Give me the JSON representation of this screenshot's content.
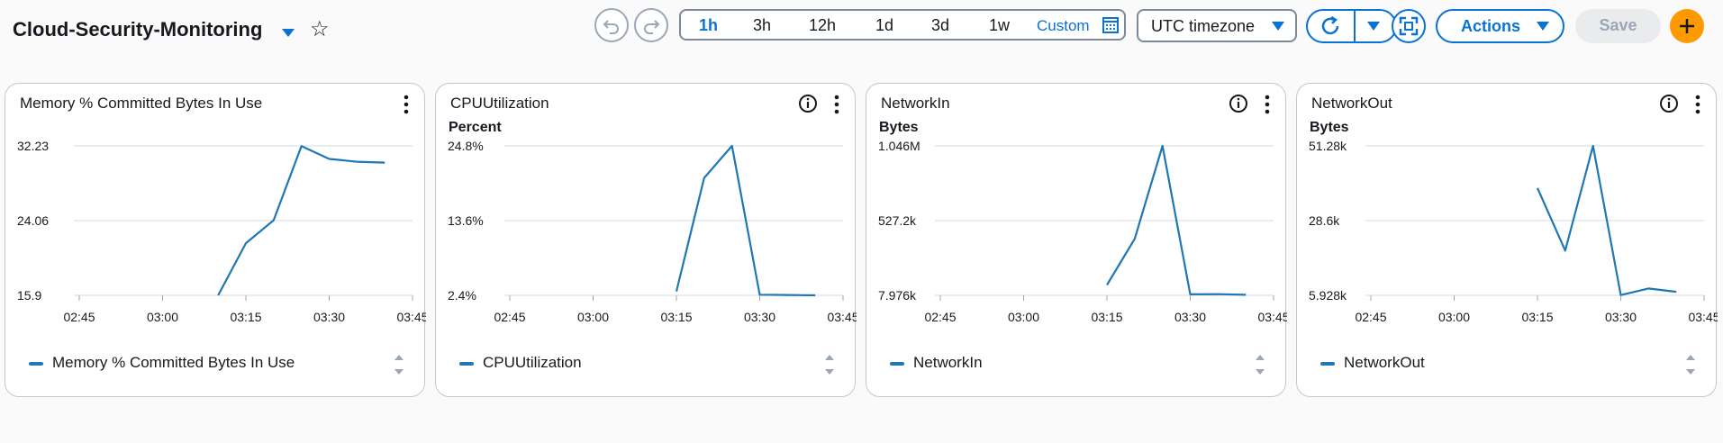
{
  "header": {
    "title": "Cloud-Security-Monitoring",
    "time_ranges": [
      {
        "label": "1h",
        "active": true
      },
      {
        "label": "3h",
        "active": false
      },
      {
        "label": "12h",
        "active": false
      },
      {
        "label": "1d",
        "active": false
      },
      {
        "label": "3d",
        "active": false
      },
      {
        "label": "1w",
        "active": false
      }
    ],
    "custom_label": "Custom",
    "timezone_label": "UTC timezone",
    "actions_label": "Actions",
    "save_label": "Save",
    "accent_color": "#0972d3",
    "add_color": "#ff9900"
  },
  "chart_data": [
    {
      "type": "line",
      "title": "Memory % Committed Bytes In Use",
      "ylabel": "",
      "yticks": [
        "32.23",
        "24.06",
        "15.9"
      ],
      "ylim": [
        15.9,
        32.23
      ],
      "xticks": [
        "02:45",
        "03:00",
        "03:15",
        "03:30",
        "03:45"
      ],
      "series": [
        {
          "name": "Memory % Committed Bytes In Use",
          "color": "#1f77b4",
          "x": [
            "03:10",
            "03:15",
            "03:20",
            "03:25",
            "03:30",
            "03:35",
            "03:40"
          ],
          "values": [
            15.9,
            21.6,
            24.1,
            32.2,
            30.8,
            30.5,
            30.4
          ]
        }
      ]
    },
    {
      "type": "line",
      "title": "CPUUtilization",
      "ylabel": "Percent",
      "yticks": [
        "24.8%",
        "13.6%",
        "2.4%"
      ],
      "ylim": [
        2.4,
        24.8
      ],
      "xticks": [
        "02:45",
        "03:00",
        "03:15",
        "03:30",
        "03:45"
      ],
      "series": [
        {
          "name": "CPUUtilization",
          "color": "#1f77b4",
          "x": [
            "03:15",
            "03:20",
            "03:25",
            "03:30",
            "03:35",
            "03:40"
          ],
          "values": [
            3.0,
            20.0,
            24.8,
            2.5,
            2.45,
            2.4
          ]
        }
      ]
    },
    {
      "type": "line",
      "title": "NetworkIn",
      "ylabel": "Bytes",
      "yticks": [
        "1.046M",
        "527.2k",
        "7.976k"
      ],
      "ylim": [
        7976,
        1046000
      ],
      "xticks": [
        "02:45",
        "03:00",
        "03:15",
        "03:30",
        "03:45"
      ],
      "series": [
        {
          "name": "NetworkIn",
          "color": "#1f77b4",
          "x": [
            "03:15",
            "03:20",
            "03:25",
            "03:30",
            "03:35",
            "03:40"
          ],
          "values": [
            80000,
            400000,
            1046000,
            15000,
            16000,
            12000
          ]
        }
      ]
    },
    {
      "type": "line",
      "title": "NetworkOut",
      "ylabel": "Bytes",
      "yticks": [
        "51.28k",
        "28.6k",
        "5.928k"
      ],
      "ylim": [
        5928,
        51280
      ],
      "xticks": [
        "02:45",
        "03:00",
        "03:15",
        "03:30",
        "03:45"
      ],
      "series": [
        {
          "name": "NetworkOut",
          "color": "#1f77b4",
          "x": [
            "03:15",
            "03:20",
            "03:25",
            "03:30",
            "03:35",
            "03:40"
          ],
          "values": [
            38500,
            19500,
            51280,
            6000,
            8000,
            7000
          ]
        }
      ]
    }
  ]
}
